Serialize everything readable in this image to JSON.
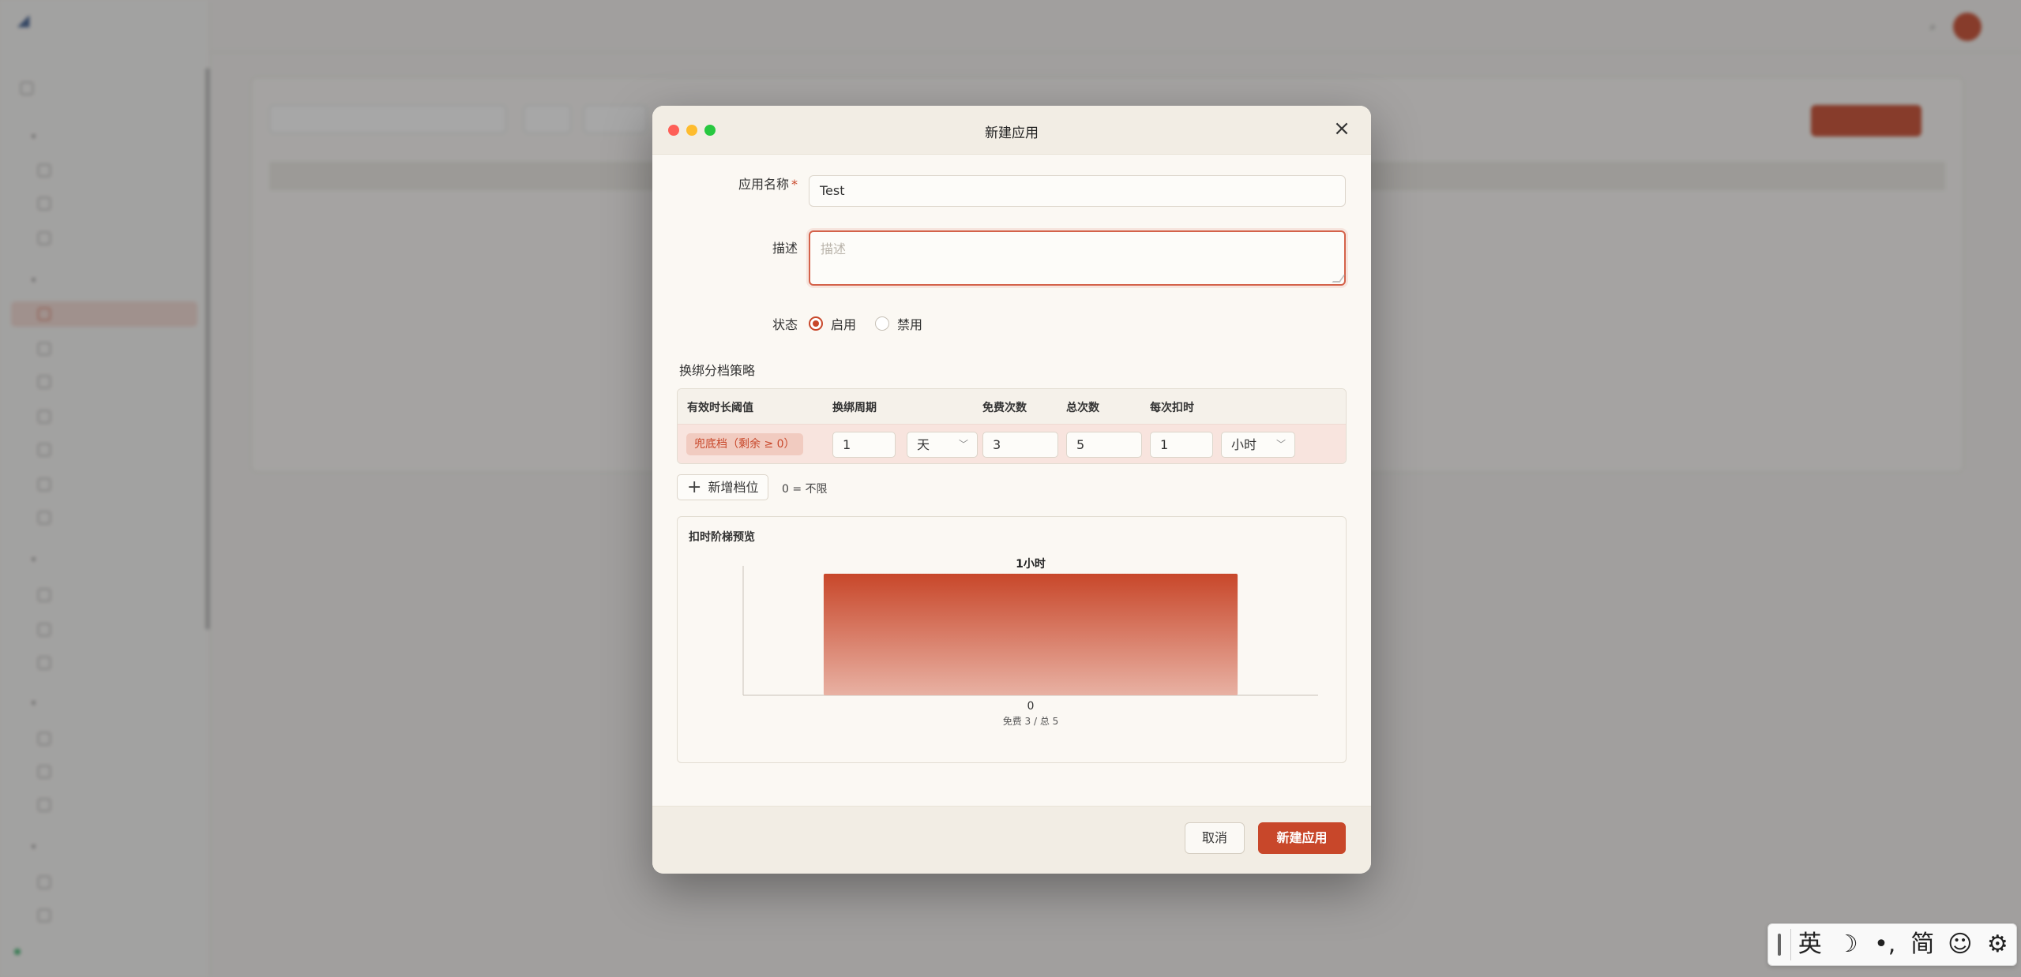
{
  "modal": {
    "title": "新建应用",
    "close_icon": "close-icon",
    "fields": {
      "name_label": "应用名称",
      "required_mark": "*",
      "name_value": "Test",
      "desc_label": "描述",
      "desc_placeholder": "描述",
      "status_label": "状态",
      "status_enabled": "启用",
      "status_disabled": "禁用",
      "status_selected": "启用"
    },
    "tier_section": {
      "title": "换绑分档策略",
      "columns": [
        "有效时长阈值",
        "换绑周期",
        "免费次数",
        "总次数",
        "每次扣时"
      ],
      "rows": [
        {
          "badge": "兜底档（剩余 ≥ 0）",
          "period_value": "1",
          "period_unit": "天",
          "free_count": "3",
          "total_count": "5",
          "deduct_value": "1",
          "deduct_unit": "小时"
        }
      ],
      "add_button": "新增档位",
      "hint": "0 = 不限"
    },
    "preview": {
      "title": "扣时阶梯预览"
    },
    "footer": {
      "cancel": "取消",
      "submit": "新建应用"
    }
  },
  "chart_data": {
    "type": "bar",
    "title": "扣时阶梯预览",
    "categories": [
      "0"
    ],
    "category_sublabels": [
      "免费 3 / 总 5"
    ],
    "values": [
      1
    ],
    "data_labels": [
      "1小时"
    ],
    "colors": {
      "bar_top": "#c8472a",
      "bar_bottom": "#e8b1a3"
    }
  },
  "ime": {
    "items": [
      "英",
      "☽",
      "•,",
      "简",
      "☺",
      "⚙"
    ]
  },
  "colors": {
    "accent": "#c8472a",
    "overlay": "rgba(45,45,45,0.42)"
  }
}
